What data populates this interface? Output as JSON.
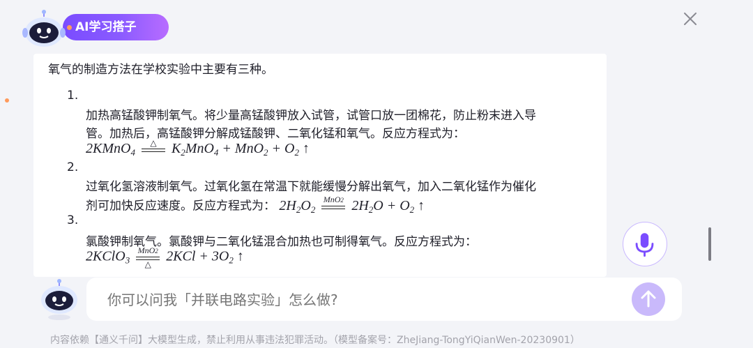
{
  "header": {
    "title": "AI学习搭子"
  },
  "answer": {
    "intro": "氧气的制造方法在学校实验中主要有三种。",
    "items": [
      {
        "num": "1.",
        "line1": "加热高锰酸钾制氧气。将少量高锰酸钾放入试管，试管口放一团棉花，防止粉末进入导",
        "line2": "管。加热后，高锰酸钾分解成锰酸钾、二氧化锰和氧气。反应方程式为：",
        "equation": "2KMnO4 =△= K2MnO4 + MnO2 + O2 ↑"
      },
      {
        "num": "2.",
        "line1": "过氧化氢溶液制氧气。过氧化氢在常温下就能缓慢分解出氧气，加入二氧化锰作为催化",
        "line2": "剂可加快反应速度。反应方程式为：",
        "equation": "2H2O2 =MnO2= 2H2O + O2 ↑"
      },
      {
        "num": "3.",
        "line1": "氯酸钾制氧气。氯酸钾与二氧化锰混合加热也可制得氧气。反应方程式为：",
        "equation": "2KClO3 =MnO2,△= 2KCl + 3O2 ↑"
      }
    ]
  },
  "input": {
    "placeholder": "你可以问我「并联电路实验」怎么做?"
  },
  "footer": {
    "disclaimer": "内容依赖【通义千问】大模型生成，禁止利用从事违法犯罪活动。（模型备案号：ZheJiang-TongYiQianWen-20230901）"
  },
  "colors": {
    "accent": "#8b5bff",
    "send_button": "#c9b9fb",
    "mic_border": "#c9b8ff"
  },
  "icons": [
    "robot-avatar-icon",
    "close-icon",
    "microphone-icon",
    "send-arrow-icon"
  ]
}
